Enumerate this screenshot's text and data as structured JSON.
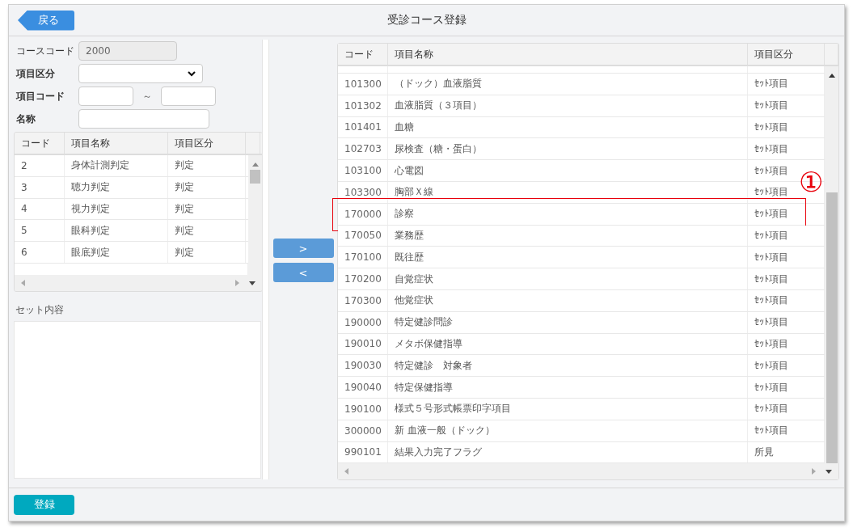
{
  "header": {
    "back_button": "戻る",
    "title": "受診コース登録"
  },
  "search_form": {
    "course_code": {
      "label": "コースコード",
      "value": "2000",
      "disabled": true
    },
    "category": {
      "label": "項目区分"
    },
    "code_range": {
      "label": "項目コード",
      "separator": "～"
    },
    "name": {
      "label": "名称"
    }
  },
  "left_table": {
    "columns": [
      "コード",
      "項目名称",
      "項目区分"
    ],
    "rows": [
      {
        "code": "2",
        "name": "身体計測判定",
        "category": "判定"
      },
      {
        "code": "3",
        "name": "聴力判定",
        "category": "判定"
      },
      {
        "code": "4",
        "name": "視力判定",
        "category": "判定"
      },
      {
        "code": "5",
        "name": "眼科判定",
        "category": "判定"
      },
      {
        "code": "6",
        "name": "眼底判定",
        "category": "判定"
      }
    ]
  },
  "set_contents": {
    "label": "セット内容"
  },
  "transfer_buttons": [
    ">",
    "<"
  ],
  "right_table": {
    "columns": [
      "コード",
      "項目名称",
      "項目区分"
    ],
    "rows": [
      {
        "code": "101300",
        "name": "（ドック）血液脂質",
        "category": "ｾｯﾄ項目",
        "annotated": false
      },
      {
        "code": "101302",
        "name": "血液脂質（３項目）",
        "category": "ｾｯﾄ項目",
        "annotated": false
      },
      {
        "code": "101401",
        "name": "血糖",
        "category": "ｾｯﾄ項目",
        "annotated": false
      },
      {
        "code": "102703",
        "name": "尿検査（糖・蛋白）",
        "category": "ｾｯﾄ項目",
        "annotated": false
      },
      {
        "code": "103100",
        "name": "心電図",
        "category": "ｾｯﾄ項目",
        "annotated": false
      },
      {
        "code": "103300",
        "name": "胸部Ｘ線",
        "category": "ｾｯﾄ項目",
        "annotated": false
      },
      {
        "code": "170000",
        "name": "診察",
        "category": "ｾｯﾄ項目",
        "annotated": true
      },
      {
        "code": "170050",
        "name": "業務歴",
        "category": "ｾｯﾄ項目",
        "annotated": false
      },
      {
        "code": "170100",
        "name": "既往歴",
        "category": "ｾｯﾄ項目",
        "annotated": false
      },
      {
        "code": "170200",
        "name": "自覚症状",
        "category": "ｾｯﾄ項目",
        "annotated": false
      },
      {
        "code": "170300",
        "name": "他覚症状",
        "category": "ｾｯﾄ項目",
        "annotated": false
      },
      {
        "code": "190000",
        "name": "特定健診問診",
        "category": "ｾｯﾄ項目",
        "annotated": false
      },
      {
        "code": "190010",
        "name": "メタボ保健指導",
        "category": "ｾｯﾄ項目",
        "annotated": false
      },
      {
        "code": "190030",
        "name": "特定健診　対象者",
        "category": "ｾｯﾄ項目",
        "annotated": false
      },
      {
        "code": "190040",
        "name": "特定保健指導",
        "category": "ｾｯﾄ項目",
        "annotated": false
      },
      {
        "code": "190100",
        "name": "様式５号形式帳票印字項目",
        "category": "ｾｯﾄ項目",
        "annotated": false
      },
      {
        "code": "300000",
        "name": "新 血液一般（ドック）",
        "category": "ｾｯﾄ項目",
        "annotated": false
      },
      {
        "code": "990101",
        "name": "結果入力完了フラグ",
        "category": "所見",
        "annotated": false
      }
    ]
  },
  "annotation": {
    "label": "①"
  },
  "footer": {
    "register_button": "登録"
  }
}
